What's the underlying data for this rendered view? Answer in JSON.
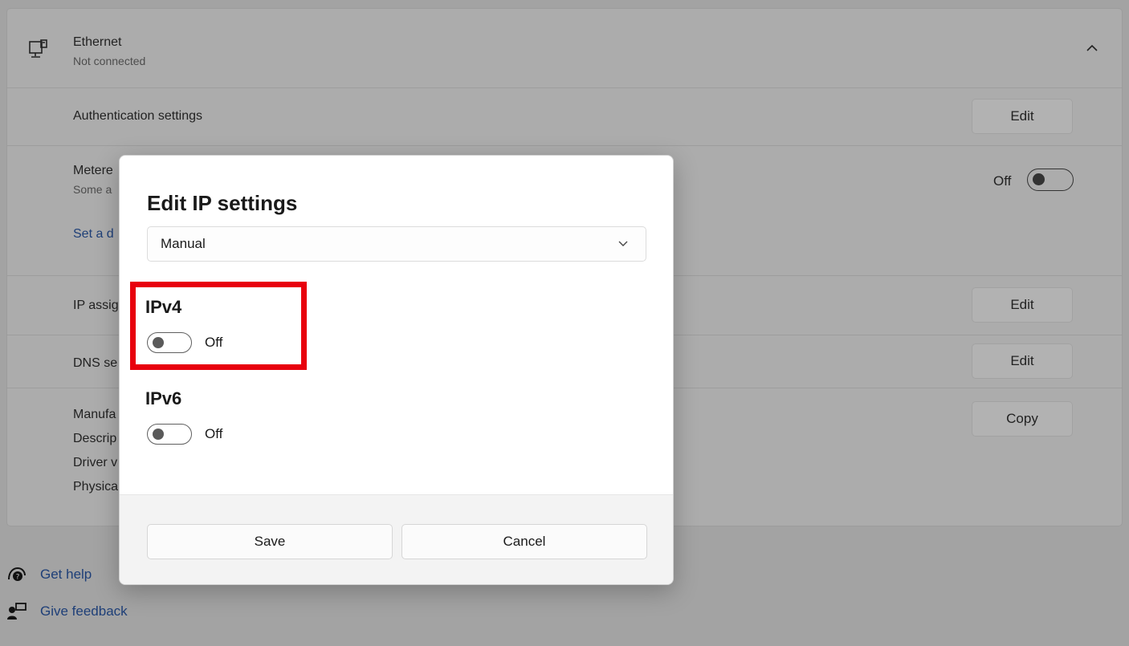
{
  "ethernet": {
    "title": "Ethernet",
    "status": "Not connected"
  },
  "rows": {
    "auth_label": "Authentication settings",
    "auth_button": "Edit",
    "metered_label": "Metere",
    "metered_sub": "Some a",
    "metered_toggle_label": "Off",
    "data_limit_link": "Set a d",
    "ip_label": "IP assig",
    "ip_button": "Edit",
    "dns_label": "DNS se",
    "dns_button": "Edit",
    "props": [
      "Manufa",
      "Descrip",
      "Driver v",
      "Physica"
    ],
    "copy_button": "Copy"
  },
  "help": {
    "get_help": "Get help",
    "give_feedback": "Give feedback"
  },
  "dialog": {
    "title": "Edit IP settings",
    "mode_value": "Manual",
    "ipv4": {
      "label": "IPv4",
      "toggle_label": "Off",
      "value": false
    },
    "ipv6": {
      "label": "IPv6",
      "toggle_label": "Off",
      "value": false
    },
    "save_label": "Save",
    "cancel_label": "Cancel"
  },
  "colors": {
    "highlight": "#e8000d",
    "link": "#1e3f78",
    "overlay": "#acacac"
  }
}
